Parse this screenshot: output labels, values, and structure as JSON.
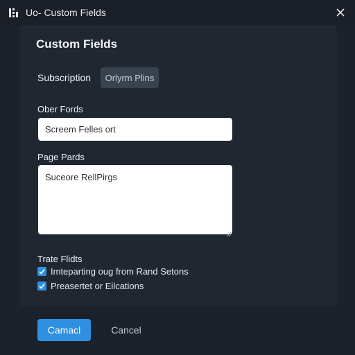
{
  "window": {
    "title": "Uo- Custom Fields",
    "app_icon": "grid-app-icon",
    "close_icon": "close-icon"
  },
  "dialog": {
    "title": "Custom Fields"
  },
  "tabs": [
    {
      "label": "Subscription",
      "active": false
    },
    {
      "label": "Orlyrm Plins",
      "active": true
    }
  ],
  "fields": {
    "other": {
      "label": "Ober Fords",
      "value": "Screem Felles ort"
    },
    "page": {
      "label": "Page Pards",
      "value": "Suceore RellPirgs"
    },
    "state": {
      "label": "Trate Flidts",
      "options": [
        {
          "label": "Imteparting oug from Rand Setons",
          "checked": true
        },
        {
          "label": "Preasertet or Eilcations",
          "checked": true
        }
      ]
    }
  },
  "actions": {
    "primary_label": "Camacl",
    "secondary_label": "Cancel"
  },
  "colors": {
    "accent": "#2f8fe0",
    "background": "#1c222b",
    "panel": "#202731",
    "active_tab": "#39434f"
  }
}
